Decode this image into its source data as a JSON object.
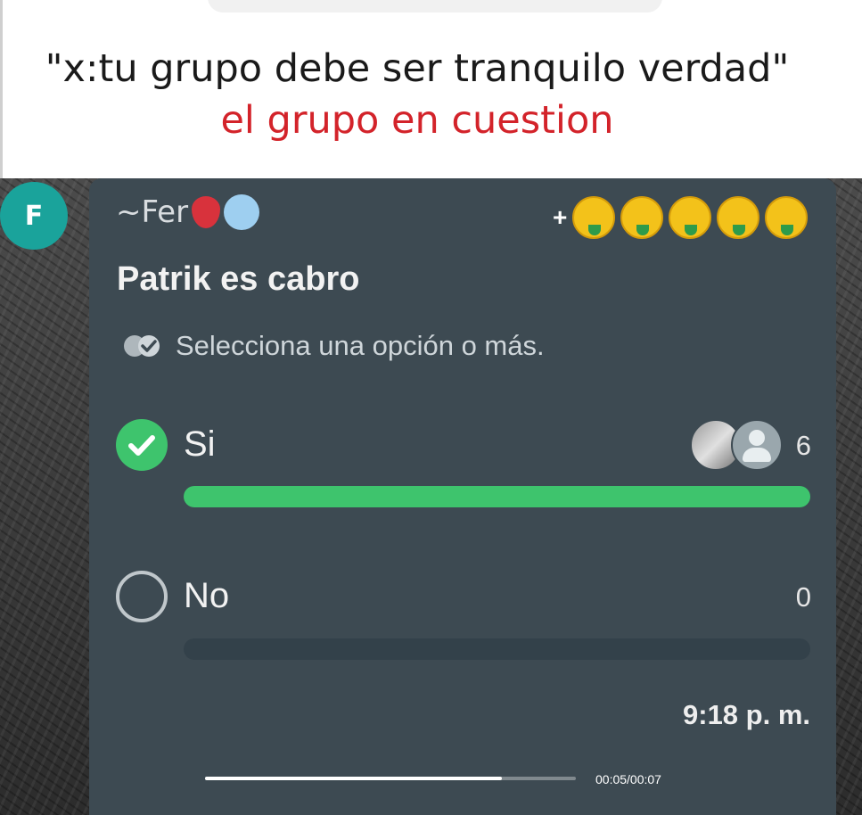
{
  "caption": {
    "line1": "\"x:tu grupo debe ser tranquilo verdad\"",
    "line2": "el grupo en cuestion",
    "line2_color": "#d3232a"
  },
  "chat": {
    "avatar_letter": "F",
    "avatar_color": "#1aa39b",
    "sender_name": "~Fer",
    "sender_emojis": [
      "strawberry-icon",
      "cold-face-icon"
    ],
    "phone_prefix": "+",
    "phone_emojis": [
      "money-mouth-face-icon",
      "money-mouth-face-icon",
      "money-mouth-face-icon",
      "money-mouth-face-icon",
      "money-mouth-face-icon"
    ],
    "poll": {
      "title": "Patrik es cabro",
      "instruction": "Selecciona una opción o más.",
      "options": [
        {
          "label": "Si",
          "selected": true,
          "votes": "6",
          "fraction": 1.0
        },
        {
          "label": "No",
          "selected": false,
          "votes": "0",
          "fraction": 0.0
        }
      ]
    },
    "timestamp": "9:18 p. m.",
    "accent_color": "#3ec46d",
    "bubble_color": "#3d4a52"
  },
  "video": {
    "time": "00:05/00:07",
    "progress_fraction": 0.8
  }
}
